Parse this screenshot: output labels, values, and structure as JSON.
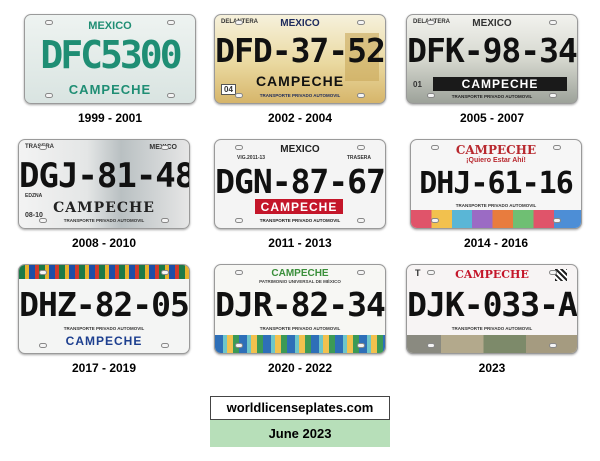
{
  "plates": [
    {
      "number": "DFC5300",
      "years": "1999 - 2001",
      "top": "MEXICO",
      "bottom": "CAMPECHE"
    },
    {
      "number": "DFD-37-52",
      "years": "2002 - 2004",
      "top": "MEXICO",
      "top_left": "DELANTERA",
      "bottom": "CAMPECHE",
      "sub": "TRANSPORTE PRIVADO AUTOMOVIL",
      "sticker": "04"
    },
    {
      "number": "DFK-98-34",
      "years": "2005 - 2007",
      "top": "MEXICO",
      "top_left": "DELANTERA",
      "bottom": "CAMPECHE",
      "sub": "TRANSPORTE PRIVADO AUTOMOVIL",
      "sticker": "01"
    },
    {
      "number": "DGJ-81-48",
      "years": "2008 - 2010",
      "top": "MEXICO",
      "top_left": "TRASERA",
      "bottom": "CAMPECHE",
      "sub": "TRANSPORTE PRIVADO AUTOMOVIL",
      "left_mark": "EDZNA",
      "sticker": "08-10"
    },
    {
      "number": "DGN-87-67",
      "years": "2011 - 2013",
      "top": "MEXICO",
      "top_left": "VIG.2011-13",
      "top_right": "TRASERA",
      "bottom": "CAMPECHE",
      "sub": "TRANSPORTE PRIVADO AUTOMOVIL",
      "sticker": "04"
    },
    {
      "number": "DHJ-61-16",
      "years": "2014 - 2016",
      "top": "CAMPECHE",
      "slogan": "¡Quiero Estar Ahí!",
      "sub": "TRANSPORTE PRIVADO AUTOMOVIL"
    },
    {
      "number": "DHZ-82-05",
      "years": "2017 - 2019",
      "bottom": "CAMPECHE",
      "sub": "TRANSPORTE PRIVADO AUTOMOVIL"
    },
    {
      "number": "DJR-82-34",
      "years": "2020 - 2022",
      "top": "CAMPECHE",
      "subtitle": "PATRIMONIO UNIVERSAL DE MÉXICO",
      "sub": "TRANSPORTE PRIVADO AUTOMOVIL"
    },
    {
      "number": "DJK-033-A",
      "years": "2023",
      "top": "CAMPECHE",
      "top_left": "T",
      "sub": "TRANSPORTE PRIVADO AUTOMOVIL"
    }
  ],
  "footer": {
    "site": "worldlicenseplates.com",
    "date": "June 2023"
  },
  "colors": {
    "teal": "#1f8e74",
    "gold": "#e2c06b",
    "darkblue": "#1c2a5c",
    "red": "#c4162a",
    "green_box": "#b7dfb9"
  }
}
